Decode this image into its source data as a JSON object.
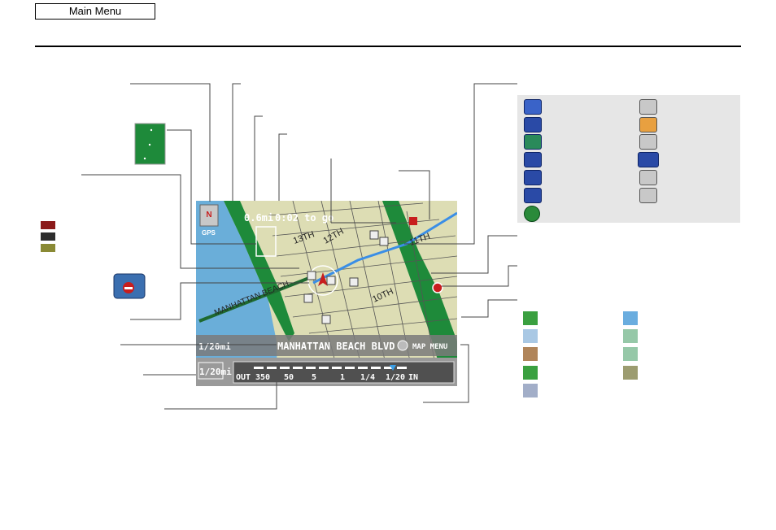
{
  "header": {
    "main_menu_label": "Main Menu"
  },
  "nav_screen": {
    "north_label": "N",
    "gps_label": "GPS",
    "distance": "0.6mi",
    "time_to_go": "0:02 to go",
    "street_name": "MANHATTAN BEACH BLVD",
    "map_menu": "MAP MENU",
    "scale_label": "1/20mi",
    "scale_label_lower": "1/20mi",
    "zoom_out": "OUT",
    "zoom_in": "IN",
    "zoom_levels": [
      "350",
      "50",
      "5",
      "1",
      "1/4",
      "1/20"
    ],
    "street_labels": [
      "13TH",
      "12TH",
      "11TH",
      "10TH",
      "MANHATTAN BEACH"
    ]
  },
  "poi_icons": {
    "left": [
      "honda-dealer-icon",
      "hospital-icon",
      "shopping-icon",
      "gas-station-icon",
      "hotel-icon",
      "post-office-icon",
      "info-icon"
    ],
    "right": [
      "acura-dealer-icon",
      "tourist-icon",
      "restaurant-icon",
      "atm-icon",
      "parking-icon",
      "train-station-icon"
    ]
  },
  "colors": {
    "road_red": "#8b1a1a",
    "road_dark": "#2d2d2d",
    "road_olive": "#8a8a35",
    "water": "#6aaed9",
    "park": "#1e8a3a",
    "map_land": "#ddddb4",
    "route": "#3a8ee6"
  },
  "area_swatches": {
    "left": [
      "#3aa040",
      "#a9c8e4",
      "#b0855a",
      "#3aa040",
      "#a2aec8"
    ],
    "right": [
      "#6aaddf",
      "#96c8a8",
      "#96c8a8",
      "#9c9c70"
    ]
  }
}
